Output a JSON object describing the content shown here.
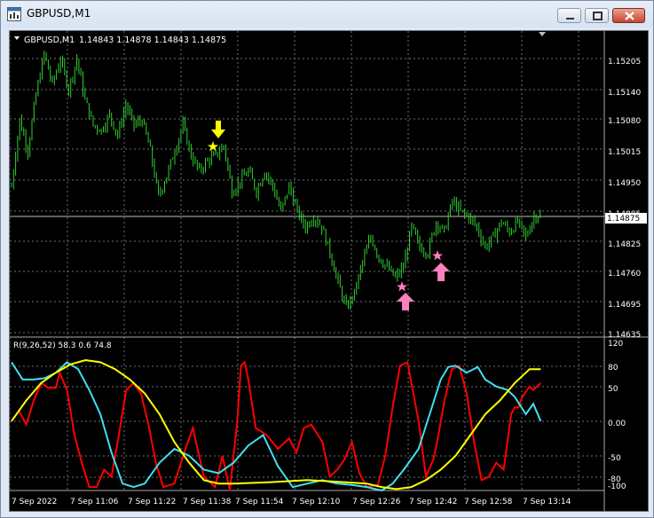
{
  "window": {
    "title": "GBPUSD,M1",
    "minimize_label": "minimize",
    "maximize_label": "maximize",
    "close_label": "close"
  },
  "chart_header": {
    "symbol_timeframe": "GBPUSD,M1",
    "ohlc": "1.14843 1.14878 1.14843 1.14875"
  },
  "colors": {
    "background": "#000000",
    "grid": "#6f6f6f",
    "candles": "#32cd32",
    "sell_arrow": "#ffff00",
    "buy_arrow": "#ff80c0",
    "oscillator_red": "#ff0000",
    "oscillator_cyan": "#40e0f0",
    "oscillator_yellow": "#ffff00",
    "axis_text": "#ffffff"
  },
  "price_axis": {
    "ticks": [
      "1.15205",
      "1.15140",
      "1.15080",
      "1.15015",
      "1.14950",
      "1.14885",
      "1.14825",
      "1.14760",
      "1.14695",
      "1.14635"
    ],
    "current_price": "1.14875"
  },
  "indicator": {
    "label": "R(9,26,52) 58.3 0.6 74.8",
    "axis_ticks": [
      "120",
      "80",
      "50",
      "0.00",
      "-50",
      "-80",
      "-100"
    ]
  },
  "time_axis": {
    "ticks": [
      "7 Sep 2022",
      "7 Sep 11:06",
      "7 Sep 11:22",
      "7 Sep 11:38",
      "7 Sep 11:54",
      "7 Sep 12:10",
      "7 Sep 12:26",
      "7 Sep 12:42",
      "7 Sep 12:58",
      "7 Sep 13:14"
    ]
  },
  "signals": [
    {
      "type": "sell",
      "marker": "star",
      "icon": "down-arrow-icon"
    },
    {
      "type": "buy",
      "marker": "star",
      "icon": "up-arrow-icon"
    },
    {
      "type": "buy",
      "marker": "star",
      "icon": "up-arrow-icon"
    }
  ],
  "chart_data": {
    "type": "candlestick-with-oscillator",
    "symbol": "GBPUSD",
    "timeframe": "M1",
    "price_range": [
      1.14635,
      1.15235
    ],
    "close_trace": [
      [
        0,
        1.1493
      ],
      [
        4,
        1.1506
      ],
      [
        8,
        1.15
      ],
      [
        12,
        1.1511
      ],
      [
        16,
        1.1519
      ],
      [
        20,
        1.1513
      ],
      [
        24,
        1.1518
      ],
      [
        28,
        1.1512
      ],
      [
        32,
        1.1518
      ],
      [
        36,
        1.151
      ],
      [
        40,
        1.1505
      ],
      [
        44,
        1.1504
      ],
      [
        48,
        1.1507
      ],
      [
        52,
        1.1503
      ],
      [
        56,
        1.1509
      ],
      [
        60,
        1.1505
      ],
      [
        64,
        1.1506
      ],
      [
        68,
        1.15
      ],
      [
        72,
        1.1491
      ],
      [
        76,
        1.1495
      ],
      [
        80,
        1.15
      ],
      [
        84,
        1.1505
      ],
      [
        88,
        1.1499
      ],
      [
        92,
        1.1496
      ],
      [
        96,
        1.1498
      ],
      [
        100,
        1.1499
      ],
      [
        104,
        1.1501
      ],
      [
        108,
        1.1492
      ],
      [
        112,
        1.1494
      ],
      [
        116,
        1.1496
      ],
      [
        120,
        1.1492
      ],
      [
        124,
        1.1496
      ],
      [
        128,
        1.1493
      ],
      [
        132,
        1.1488
      ],
      [
        136,
        1.1493
      ],
      [
        140,
        1.1488
      ],
      [
        144,
        1.1485
      ],
      [
        148,
        1.1487
      ],
      [
        152,
        1.1485
      ],
      [
        156,
        1.148
      ],
      [
        160,
        1.1474
      ],
      [
        164,
        1.1469
      ],
      [
        168,
        1.1472
      ],
      [
        172,
        1.1478
      ],
      [
        176,
        1.1483
      ],
      [
        180,
        1.1479
      ],
      [
        184,
        1.1477
      ],
      [
        188,
        1.1475
      ],
      [
        192,
        1.1477
      ],
      [
        196,
        1.1485
      ],
      [
        200,
        1.1481
      ],
      [
        204,
        1.148
      ],
      [
        208,
        1.1486
      ],
      [
        212,
        1.1484
      ],
      [
        216,
        1.149
      ],
      [
        220,
        1.1488
      ],
      [
        224,
        1.1487
      ],
      [
        228,
        1.1485
      ],
      [
        232,
        1.1481
      ],
      [
        236,
        1.1483
      ],
      [
        240,
        1.1486
      ],
      [
        244,
        1.1484
      ],
      [
        248,
        1.1486
      ],
      [
        252,
        1.1483
      ],
      [
        256,
        1.1487
      ],
      [
        259,
        1.14875
      ]
    ],
    "oscillator_range": [
      -100,
      120
    ],
    "series": [
      {
        "color": "#ff0000",
        "values": [
          [
            0,
            0
          ],
          [
            2,
            15
          ],
          [
            4,
            -5
          ],
          [
            6,
            30
          ],
          [
            8,
            55
          ],
          [
            10,
            48
          ],
          [
            12,
            48
          ],
          [
            13,
            70
          ],
          [
            15,
            45
          ],
          [
            17,
            -20
          ],
          [
            19,
            -60
          ],
          [
            21,
            -95
          ],
          [
            23,
            -95
          ],
          [
            25,
            -70
          ],
          [
            27,
            -80
          ],
          [
            29,
            -20
          ],
          [
            31,
            45
          ],
          [
            33,
            55
          ],
          [
            35,
            40
          ],
          [
            37,
            -5
          ],
          [
            39,
            -60
          ],
          [
            41,
            -95
          ],
          [
            44,
            -90
          ],
          [
            47,
            -40
          ],
          [
            49,
            -10
          ],
          [
            52,
            -80
          ],
          [
            55,
            -95
          ],
          [
            57,
            -50
          ],
          [
            59,
            -100
          ],
          [
            61,
            0
          ],
          [
            62,
            80
          ],
          [
            63,
            85
          ],
          [
            64,
            60
          ],
          [
            66,
            -10
          ],
          [
            69,
            -20
          ],
          [
            72,
            -40
          ],
          [
            75,
            -25
          ],
          [
            77,
            -45
          ],
          [
            79,
            -10
          ],
          [
            81,
            -5
          ],
          [
            84,
            -30
          ],
          [
            86,
            -80
          ],
          [
            88,
            -70
          ],
          [
            90,
            -55
          ],
          [
            92,
            -30
          ],
          [
            94,
            -75
          ],
          [
            96,
            -95
          ],
          [
            99,
            -92
          ],
          [
            101,
            -50
          ],
          [
            103,
            20
          ],
          [
            105,
            80
          ],
          [
            107,
            85
          ],
          [
            110,
            0
          ],
          [
            112,
            -80
          ],
          [
            114,
            -55
          ],
          [
            115,
            -30
          ],
          [
            117,
            30
          ],
          [
            119,
            75
          ],
          [
            121,
            80
          ],
          [
            123,
            40
          ],
          [
            125,
            -30
          ],
          [
            127,
            -85
          ],
          [
            129,
            -80
          ],
          [
            131,
            -60
          ],
          [
            133,
            -70
          ],
          [
            135,
            10
          ],
          [
            136,
            20
          ],
          [
            137,
            20
          ],
          [
            138,
            35
          ],
          [
            140,
            50
          ],
          [
            141,
            45
          ],
          [
            143,
            55
          ]
        ]
      },
      {
        "color": "#40e0f0",
        "values": [
          [
            0,
            85
          ],
          [
            3,
            60
          ],
          [
            6,
            60
          ],
          [
            9,
            62
          ],
          [
            12,
            70
          ],
          [
            15,
            85
          ],
          [
            18,
            75
          ],
          [
            21,
            45
          ],
          [
            24,
            10
          ],
          [
            27,
            -45
          ],
          [
            30,
            -90
          ],
          [
            33,
            -95
          ],
          [
            36,
            -90
          ],
          [
            40,
            -60
          ],
          [
            44,
            -40
          ],
          [
            48,
            -50
          ],
          [
            52,
            -70
          ],
          [
            56,
            -75
          ],
          [
            60,
            -60
          ],
          [
            64,
            -35
          ],
          [
            68,
            -20
          ],
          [
            72,
            -65
          ],
          [
            76,
            -95
          ],
          [
            80,
            -90
          ],
          [
            84,
            -85
          ],
          [
            88,
            -90
          ],
          [
            92,
            -92
          ],
          [
            96,
            -95
          ],
          [
            100,
            -100
          ],
          [
            103,
            -90
          ],
          [
            106,
            -70
          ],
          [
            110,
            -40
          ],
          [
            113,
            10
          ],
          [
            116,
            60
          ],
          [
            118,
            78
          ],
          [
            120,
            80
          ],
          [
            123,
            70
          ],
          [
            126,
            78
          ],
          [
            128,
            60
          ],
          [
            131,
            50
          ],
          [
            134,
            45
          ],
          [
            136,
            35
          ],
          [
            139,
            10
          ],
          [
            141,
            25
          ],
          [
            143,
            0
          ]
        ]
      },
      {
        "color": "#ffff00",
        "values": [
          [
            0,
            0
          ],
          [
            4,
            30
          ],
          [
            8,
            55
          ],
          [
            12,
            70
          ],
          [
            16,
            82
          ],
          [
            20,
            88
          ],
          [
            24,
            85
          ],
          [
            28,
            75
          ],
          [
            32,
            60
          ],
          [
            36,
            40
          ],
          [
            40,
            10
          ],
          [
            44,
            -30
          ],
          [
            48,
            -60
          ],
          [
            52,
            -85
          ],
          [
            56,
            -90
          ],
          [
            60,
            -90
          ],
          [
            70,
            -88
          ],
          [
            80,
            -85
          ],
          [
            90,
            -88
          ],
          [
            96,
            -90
          ],
          [
            100,
            -95
          ],
          [
            104,
            -98
          ],
          [
            108,
            -95
          ],
          [
            112,
            -85
          ],
          [
            116,
            -70
          ],
          [
            120,
            -50
          ],
          [
            124,
            -20
          ],
          [
            128,
            10
          ],
          [
            132,
            30
          ],
          [
            136,
            55
          ],
          [
            140,
            75
          ],
          [
            143,
            75
          ]
        ]
      }
    ]
  }
}
